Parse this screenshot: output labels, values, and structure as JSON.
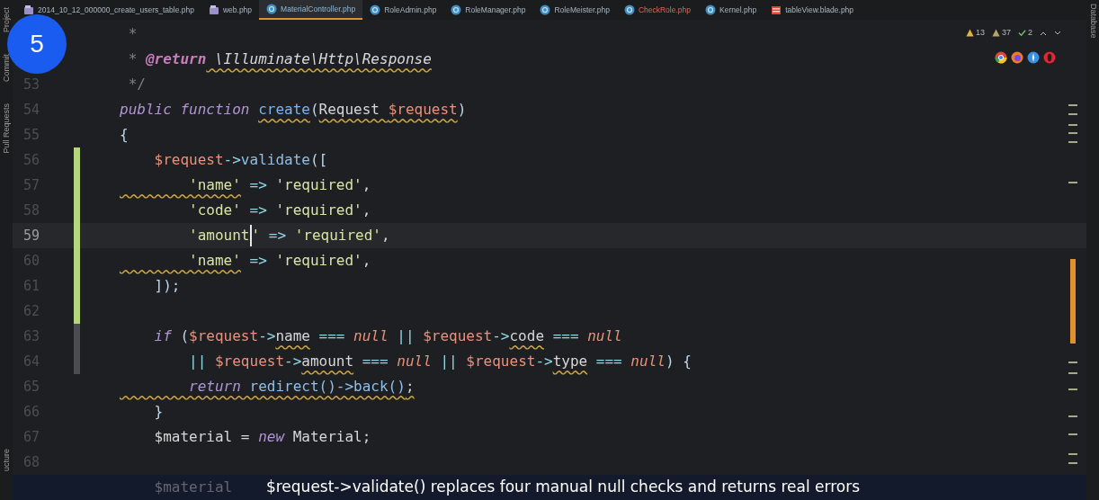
{
  "tabs": [
    {
      "label": "2014_10_12_000000_create_users_table.php",
      "kind": "db",
      "selected": false,
      "error": false
    },
    {
      "label": "web.php",
      "kind": "db",
      "selected": false,
      "error": false
    },
    {
      "label": "MaterialController.php",
      "kind": "class",
      "selected": true,
      "error": false
    },
    {
      "label": "RoleAdmin.php",
      "kind": "class",
      "selected": false,
      "error": false
    },
    {
      "label": "RoleManager.php",
      "kind": "class",
      "selected": false,
      "error": false
    },
    {
      "label": "RoleMeister.php",
      "kind": "class",
      "selected": false,
      "error": false
    },
    {
      "label": "CheckRole.php",
      "kind": "class",
      "selected": false,
      "error": true
    },
    {
      "label": "Kernel.php",
      "kind": "class",
      "selected": false,
      "error": false
    },
    {
      "label": "tableView.blade.php",
      "kind": "blade",
      "selected": false,
      "error": false
    }
  ],
  "left_tools": [
    "Project",
    "Commit",
    "Pull Requests",
    "ucture"
  ],
  "right_tools": [
    "Database"
  ],
  "step_badge": "5",
  "inspections": {
    "warnings": "13",
    "weak_warnings": "37",
    "typos": "2"
  },
  "lines": [
    {
      "added": false,
      "modified": false,
      "tokens": [
        {
          "kind": "comment",
          "text": " *"
        }
      ]
    },
    {
      "added": false,
      "modified": false,
      "current": false,
      "tokens": [
        {
          "kind": "comment",
          "text": " * "
        },
        {
          "kind": "doctag",
          "text": "@return"
        },
        {
          "kind": "doctype",
          "text": " \\Illuminate\\Http\\Response",
          "warn": true
        }
      ]
    },
    {
      "number": "53",
      "added": false,
      "modified": false,
      "current": false,
      "tokens": [
        {
          "kind": "comment",
          "text": " */"
        }
      ]
    },
    {
      "number": "54",
      "added": false,
      "modified": false,
      "current": false,
      "tokens": [
        {
          "kind": "keyword",
          "text": "public function "
        },
        {
          "kind": "function",
          "text": "create",
          "warn": true
        },
        {
          "kind": "punct",
          "text": "("
        },
        {
          "kind": "plain",
          "text": "Request ",
          "warn": true
        },
        {
          "kind": "variable",
          "text": "$request",
          "warn": true
        },
        {
          "kind": "punct",
          "text": ")"
        }
      ]
    },
    {
      "number": "55",
      "added": false,
      "modified": false,
      "current": false,
      "tokens": [
        {
          "kind": "punct",
          "text": "{"
        }
      ]
    },
    {
      "number": "56",
      "added": true,
      "modified": false,
      "current": false,
      "tokens": [
        {
          "kind": "variable",
          "text": "    $request"
        },
        {
          "kind": "operator",
          "text": "->"
        },
        {
          "kind": "method",
          "text": "validate"
        },
        {
          "kind": "punct",
          "text": "(["
        }
      ]
    },
    {
      "number": "57",
      "added": true,
      "modified": false,
      "current": false,
      "tokens": [
        {
          "kind": "string",
          "text": "        'name'",
          "warn": true
        },
        {
          "kind": "operator",
          "text": " => "
        },
        {
          "kind": "string",
          "text": "'required'"
        },
        {
          "kind": "plain",
          "text": ","
        }
      ]
    },
    {
      "number": "58",
      "added": true,
      "modified": false,
      "current": false,
      "tokens": [
        {
          "kind": "string",
          "text": "        'code'"
        },
        {
          "kind": "operator",
          "text": " => "
        },
        {
          "kind": "string",
          "text": "'required'"
        },
        {
          "kind": "plain",
          "text": ","
        }
      ]
    },
    {
      "number": "59",
      "added": true,
      "modified": false,
      "current": true,
      "tokens": [
        {
          "kind": "string",
          "text": "        'amount",
          "caret": true
        },
        {
          "kind": "string",
          "text": "'"
        },
        {
          "kind": "operator",
          "text": " => "
        },
        {
          "kind": "string",
          "text": "'required'"
        },
        {
          "kind": "plain",
          "text": ","
        }
      ]
    },
    {
      "number": "60",
      "added": true,
      "modified": false,
      "current": false,
      "tokens": [
        {
          "kind": "string",
          "text": "        'name'",
          "warn": true
        },
        {
          "kind": "operator",
          "text": " => "
        },
        {
          "kind": "string",
          "text": "'required'"
        },
        {
          "kind": "plain",
          "text": ","
        }
      ]
    },
    {
      "number": "61",
      "added": true,
      "modified": false,
      "current": false,
      "tokens": [
        {
          "kind": "punct",
          "text": "    ]);"
        }
      ]
    },
    {
      "number": "62",
      "added": true,
      "modified": false,
      "current": false
    },
    {
      "number": "63",
      "added": false,
      "modified": true,
      "current": false,
      "tokens": [
        {
          "kind": "keyword",
          "text": "    if"
        },
        {
          "kind": "punct",
          "text": " ("
        },
        {
          "kind": "variable",
          "text": "$request"
        },
        {
          "kind": "operator",
          "text": "->"
        },
        {
          "kind": "plain",
          "text": "name",
          "warn": true
        },
        {
          "kind": "operator",
          "text": " === "
        },
        {
          "kind": "constant",
          "text": "null"
        },
        {
          "kind": "operator",
          "text": " || "
        },
        {
          "kind": "variable",
          "text": "$request"
        },
        {
          "kind": "operator",
          "text": "->"
        },
        {
          "kind": "plain",
          "text": "code",
          "warn": true
        },
        {
          "kind": "operator",
          "text": " === "
        },
        {
          "kind": "constant",
          "text": "null"
        }
      ]
    },
    {
      "number": "64",
      "added": false,
      "modified": true,
      "current": false,
      "tokens": [
        {
          "kind": "operator",
          "text": "        || "
        },
        {
          "kind": "variable",
          "text": "$request"
        },
        {
          "kind": "operator",
          "text": "->"
        },
        {
          "kind": "plain",
          "text": "amount",
          "warn": true
        },
        {
          "kind": "operator",
          "text": " === "
        },
        {
          "kind": "constant",
          "text": "null"
        },
        {
          "kind": "operator",
          "text": " || "
        },
        {
          "kind": "variable",
          "text": "$request"
        },
        {
          "kind": "operator",
          "text": "->"
        },
        {
          "kind": "plain",
          "text": "type",
          "warn": true
        },
        {
          "kind": "operator",
          "text": " === "
        },
        {
          "kind": "constant",
          "text": "null"
        },
        {
          "kind": "punct",
          "text": ") {"
        }
      ]
    },
    {
      "number": "65",
      "added": false,
      "modified": false,
      "current": false,
      "tokens": [
        {
          "kind": "keyword",
          "text": "        return",
          "warn": true
        },
        {
          "kind": "method",
          "text": " redirect()->back()",
          "warn": true
        },
        {
          "kind": "plain",
          "text": ";",
          "warn": true
        }
      ]
    },
    {
      "number": "66",
      "added": false,
      "modified": false,
      "current": false,
      "tokens": [
        {
          "kind": "punct",
          "text": "    }"
        }
      ]
    },
    {
      "number": "67",
      "added": false,
      "modified": false,
      "current": false,
      "tokens": [
        {
          "kind": "plain",
          "text": "    $material = "
        },
        {
          "kind": "keyword",
          "text": "new"
        },
        {
          "kind": "plain",
          "text": " Material;"
        }
      ]
    },
    {
      "number": "68",
      "added": false,
      "modified": false,
      "current": false
    }
  ],
  "hidden_line": {
    "tokens": [
      {
        "kind": "plain",
        "text": "    $material"
      }
    ]
  },
  "caption": "$request->validate() replaces four manual null checks and returns real errors"
}
